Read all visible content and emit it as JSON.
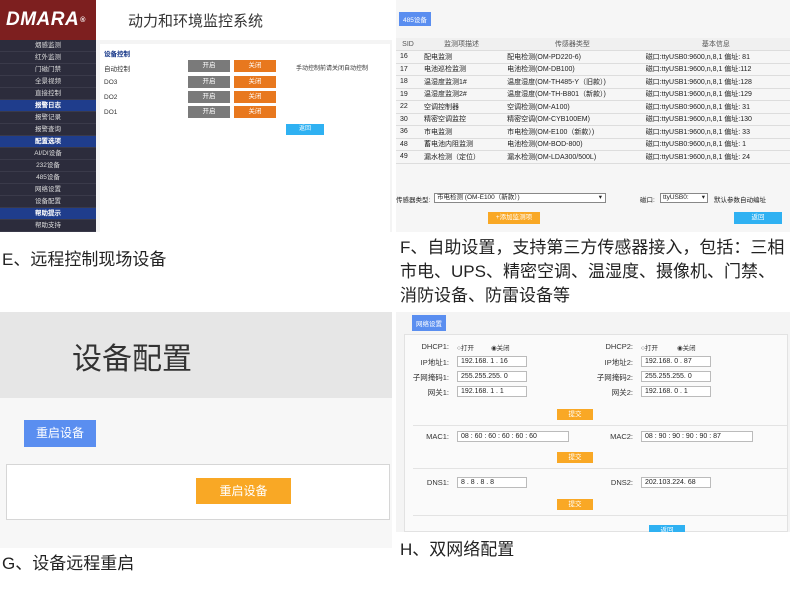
{
  "panelE": {
    "logo": "DMARA",
    "logo_mark": "®",
    "title": "动力和环境监控系统",
    "sidebar": [
      {
        "label": "烟感监测",
        "head": false
      },
      {
        "label": "红外监测",
        "head": false
      },
      {
        "label": "门磁门禁",
        "head": false
      },
      {
        "label": "全景视频",
        "head": false
      },
      {
        "label": "直接控制",
        "head": false
      },
      {
        "label": "报警日志",
        "head": true
      },
      {
        "label": "报警记录",
        "head": false
      },
      {
        "label": "报警查询",
        "head": false
      },
      {
        "label": "配置选项",
        "head": true
      },
      {
        "label": "AI/DI设备",
        "head": false
      },
      {
        "label": "232设备",
        "head": false
      },
      {
        "label": "485设备",
        "head": false
      },
      {
        "label": "网络设置",
        "head": false
      },
      {
        "label": "设备配置",
        "head": false
      },
      {
        "label": "帮助提示",
        "head": true
      },
      {
        "label": "帮助支持",
        "head": false
      }
    ],
    "section": "设备控制",
    "rows": [
      {
        "label": "自动控制",
        "on": "开启",
        "off": "关闭",
        "note": "手动控制前请关闭自动控制"
      },
      {
        "label": "DO3",
        "on": "开启",
        "off": "关闭",
        "note": ""
      },
      {
        "label": "DO2",
        "on": "开启",
        "off": "关闭",
        "note": ""
      },
      {
        "label": "DO1",
        "on": "开启",
        "off": "关闭",
        "note": ""
      }
    ],
    "return_label": "返回"
  },
  "captionE": "E、远程控制现场设备",
  "panelF": {
    "tag": "485设备",
    "columns": [
      "SID",
      "监测项描述",
      "传感器类型",
      "基本信息"
    ],
    "rows": [
      {
        "sid": "16",
        "desc": "配电监测",
        "type": "配电检测(OM-PD220-6)",
        "info": "磁口:ttyUSB0:9600,n,8,1 偏址: 81"
      },
      {
        "sid": "17",
        "desc": "电池巡检监测",
        "type": "电池检测(OM-DB100)",
        "info": "磁口:ttyUSB1:9600,n,8,1 偏址:112"
      },
      {
        "sid": "18",
        "desc": "温湿度监测1#",
        "type": "温度湿度(OM-TH485-Y（旧款）)",
        "info": "磁口:ttyUSB1:9600,n,8,1 偏址:128"
      },
      {
        "sid": "19",
        "desc": "温湿度监测2#",
        "type": "温度湿度(OM-TH-B801（新款）)",
        "info": "磁口:ttyUSB1:9600,n,8,1 偏址:129"
      },
      {
        "sid": "22",
        "desc": "空调控制器",
        "type": "空调检测(OM-A100)",
        "info": "磁口:ttyUSB0:9600,n,8,1 偏址: 31"
      },
      {
        "sid": "30",
        "desc": "精密空调监控",
        "type": "精密空调(OM-CYB100EM)",
        "info": "磁口:ttyUSB1:9600,n,8,1 偏址:130"
      },
      {
        "sid": "36",
        "desc": "市电监测",
        "type": "市电检测(OM-E100（新款）)",
        "info": "磁口:ttyUSB1:9600,n,8,1 偏址: 33"
      },
      {
        "sid": "48",
        "desc": "蓄电池内阻监测",
        "type": "电池检测(OM-BOD-800)",
        "info": "磁口:ttyUSB0:9600,n,8,1 偏址: 1"
      },
      {
        "sid": "49",
        "desc": "漏水检测（定位）",
        "type": "漏水检测(OM-LDA300/500L)",
        "info": "磁口:ttyUSB1:9600,n,8,1 偏址: 24"
      }
    ],
    "sensor_type_label": "传感器类型:",
    "sensor_type_value": "市电检测 (OM-E100（新款）)",
    "port_label": "磁口:",
    "port_value": "ttyUSB0:",
    "auto_addr": "默认参数自动编址",
    "add_button": "+添加监测项",
    "return_button": "返回"
  },
  "captionF": "F、自助设置，支持第三方传感器接入，包括：三相市电、UPS、精密空调、温湿度、摄像机、门禁、消防设备、防雷设备等",
  "panelG": {
    "title": "设备配置",
    "reboot_1": "重启设备",
    "reboot_2": "重启设备"
  },
  "captionG": "G、设备远程重启",
  "panelH": {
    "tag": "网络设置",
    "dhcp1_label": "DHCP1:",
    "dhcp2_label": "DHCP2:",
    "open": "打开",
    "close": "关闭",
    "ip1_label": "IP地址1:",
    "ip1": "192.168. 1 . 16",
    "ip2_label": "IP地址2:",
    "ip2": "192.168. 0 . 87",
    "mask1_label": "子网掩码1:",
    "mask1": "255.255.255. 0",
    "mask2_label": "子网掩码2:",
    "mask2": "255.255.255. 0",
    "gw1_label": "网关1:",
    "gw1": "192.168. 1 . 1",
    "gw2_label": "网关2:",
    "gw2": "192.168. 0 . 1",
    "submit": "提交",
    "mac1_label": "MAC1:",
    "mac1": "08 : 60 : 60 : 60 : 60 : 60",
    "mac2_label": "MAC2:",
    "mac2": "08 : 90 : 90 : 90 : 90 : 87",
    "dns1_label": "DNS1:",
    "dns1": "8 . 8 . 8 . 8",
    "dns2_label": "DNS2:",
    "dns2": "202.103.224. 68",
    "return_partial": "返回"
  },
  "captionH": "H、双网络配置"
}
